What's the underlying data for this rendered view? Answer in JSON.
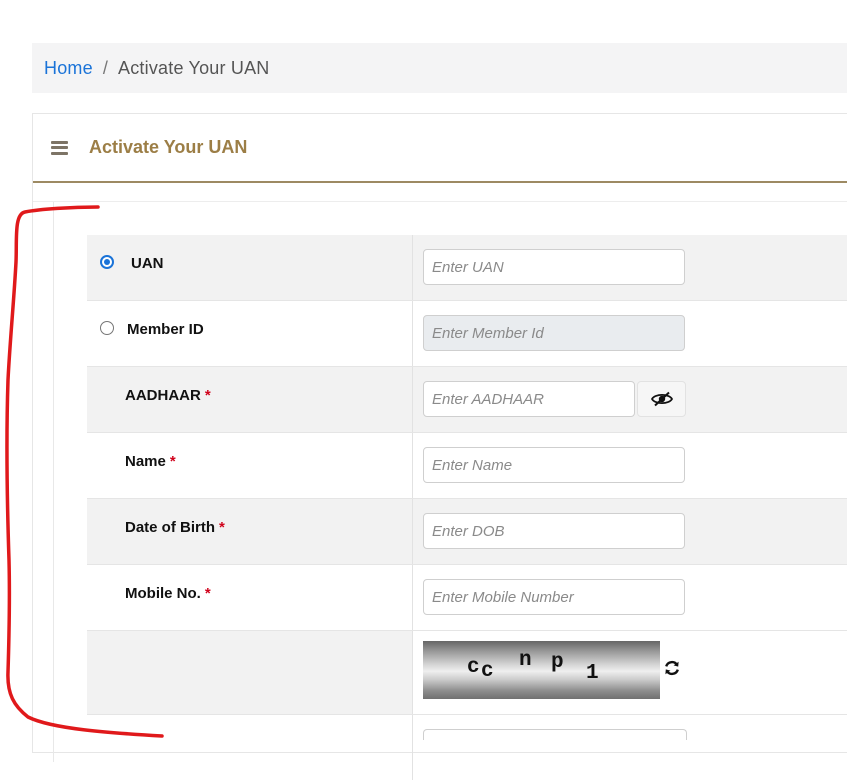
{
  "breadcrumb": {
    "home": "Home",
    "separator": "/",
    "current": "Activate Your UAN"
  },
  "card": {
    "title": "Activate Your UAN",
    "menu_icon": "hamburger-menu-icon"
  },
  "form": {
    "uan": {
      "label": "UAN",
      "placeholder": "Enter UAN",
      "selected": true
    },
    "member_id": {
      "label": "Member ID",
      "placeholder": "Enter Member Id",
      "selected": false
    },
    "aadhaar": {
      "label": "AADHAAR",
      "required": "*",
      "placeholder": "Enter AADHAAR",
      "toggle_icon": "eye-slash-icon"
    },
    "name": {
      "label": "Name",
      "required": "*",
      "placeholder": "Enter Name"
    },
    "dob": {
      "label": "Date of Birth",
      "required": "*",
      "placeholder": "Enter DOB"
    },
    "mobile": {
      "label": "Mobile No.",
      "required": "*",
      "placeholder": "Enter Mobile Number"
    },
    "captcha": {
      "chars": [
        "c",
        "c",
        "n",
        "p",
        "1"
      ],
      "refresh_icon": "refresh-icon"
    }
  },
  "colors": {
    "link": "#1a73d8",
    "title": "#9c7e46",
    "header_rule": "#9d8a63",
    "required": "#d0021b",
    "annotation": "#e0191b",
    "row_shade": "#f2f2f2"
  }
}
